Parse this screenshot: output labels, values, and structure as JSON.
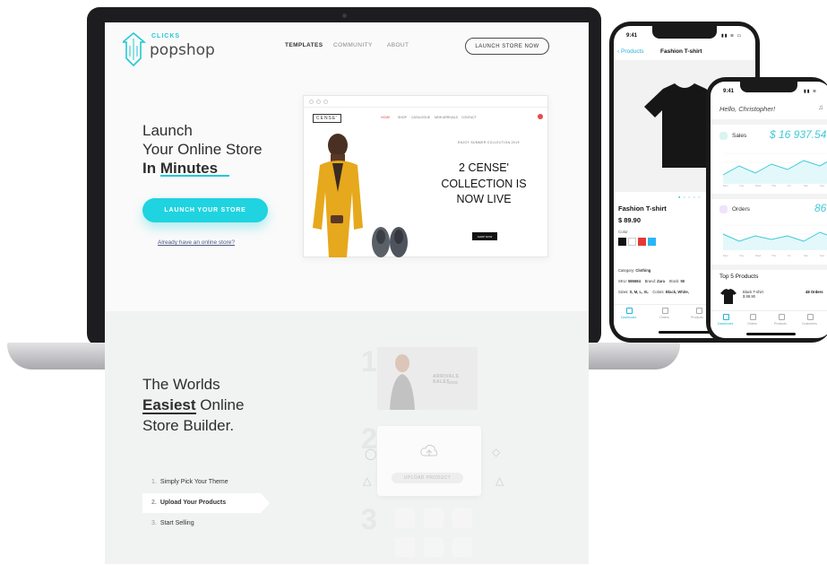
{
  "site": {
    "logo_small": "CLICKS",
    "logo_name": "popshop",
    "nav": [
      "TEMPLATES",
      "COMMUNITY",
      "ABOUT"
    ],
    "nav_cta": "LAUNCH STORE NOW"
  },
  "hero": {
    "line1": "Launch",
    "line2": "Your Online Store",
    "line3_a": "In ",
    "line3_b": "Minutes",
    "cta": "LAUNCH YOUR STORE",
    "link": "Already have an online store?"
  },
  "preview": {
    "brand": "CENSE'",
    "nav": [
      "HOME",
      "SHOP",
      "CATALOGUE",
      "NEW ARRIVALS",
      "CONTACT"
    ],
    "small": "ENJOY SUMMER COLLECTION 2019",
    "headline_1": "2 CENSE'",
    "headline_2": "COLLECTION IS",
    "headline_3": "NOW LIVE",
    "button": "SHOP NOW"
  },
  "builder": {
    "title_1": "The Worlds",
    "title_2a": "Easiest",
    "title_2b": " Online",
    "title_3": "Store Builder.",
    "steps": [
      {
        "n": "1.",
        "label": "Simply Pick Your Theme"
      },
      {
        "n": "2.",
        "label": "Upload Your Products"
      },
      {
        "n": "3.",
        "label": "Start Selling"
      }
    ],
    "numbers": [
      "1",
      "2",
      "3"
    ],
    "arrivals": "ARRIVALS SALES",
    "upload": "UPLOAD PRODUCT"
  },
  "phone1": {
    "time": "9:41",
    "back": "Products",
    "title": "Fashion T-shirt",
    "name": "Fashion T-shirt",
    "price": "$ 89.90",
    "color_label": "Color",
    "category_label": "Category:",
    "category": "Clothing",
    "sku_label": "SKU:",
    "sku": "586684",
    "brand_label": "Brand:",
    "brand": "Zara",
    "stock_label": "Stock:",
    "stock": "50",
    "sizes_label": "Sizes:",
    "sizes": "S, M, L, XL",
    "colors_label": "Colors:",
    "colors": "Black, White,",
    "tabs": [
      "Dashboard",
      "Orders",
      "Products"
    ],
    "swatches": [
      "#111111",
      "#ffffff",
      "#e53935",
      "#29b6f6"
    ]
  },
  "phone2": {
    "time": "9:41",
    "greeting": "Hello, Christopher!",
    "sales_label": "Sales",
    "sales_value": "$ 16 937.54",
    "orders_label": "Orders",
    "orders_value": "86",
    "top_label": "Top 5 Products",
    "product": "Black T-shirt",
    "product_price": "$ 88.90",
    "product_orders": "48 Orders",
    "tabs": [
      "Dashboard",
      "Orders",
      "Products",
      "Customers"
    ],
    "weekdays": [
      "Mon",
      "Tue",
      "Wed",
      "Thu",
      "Fri",
      "Sat",
      "Sun"
    ]
  },
  "colors": {
    "accent": "#1fd3e0",
    "phone_accent": "#23b4d6"
  }
}
